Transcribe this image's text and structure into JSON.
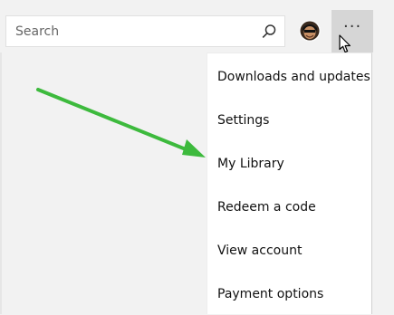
{
  "header": {
    "search": {
      "placeholder": "Search"
    },
    "icons": {
      "search": "search-icon",
      "avatar": "user-avatar",
      "more": "more-options-icon",
      "cursor": "mouse-pointer-icon"
    },
    "more_label": "···"
  },
  "menu": {
    "items": [
      {
        "label": "Downloads and updates"
      },
      {
        "label": "Settings"
      },
      {
        "label": "My Library"
      },
      {
        "label": "Redeem a code"
      },
      {
        "label": "View account"
      },
      {
        "label": "Payment options"
      }
    ],
    "highlight_target": "My Library"
  },
  "colors": {
    "accent_arrow": "#3dba3d",
    "topbar": "#f2f2f2",
    "more_button_active": "#d6d6d6",
    "menu_bg": "#ffffff",
    "text": "#111111"
  }
}
